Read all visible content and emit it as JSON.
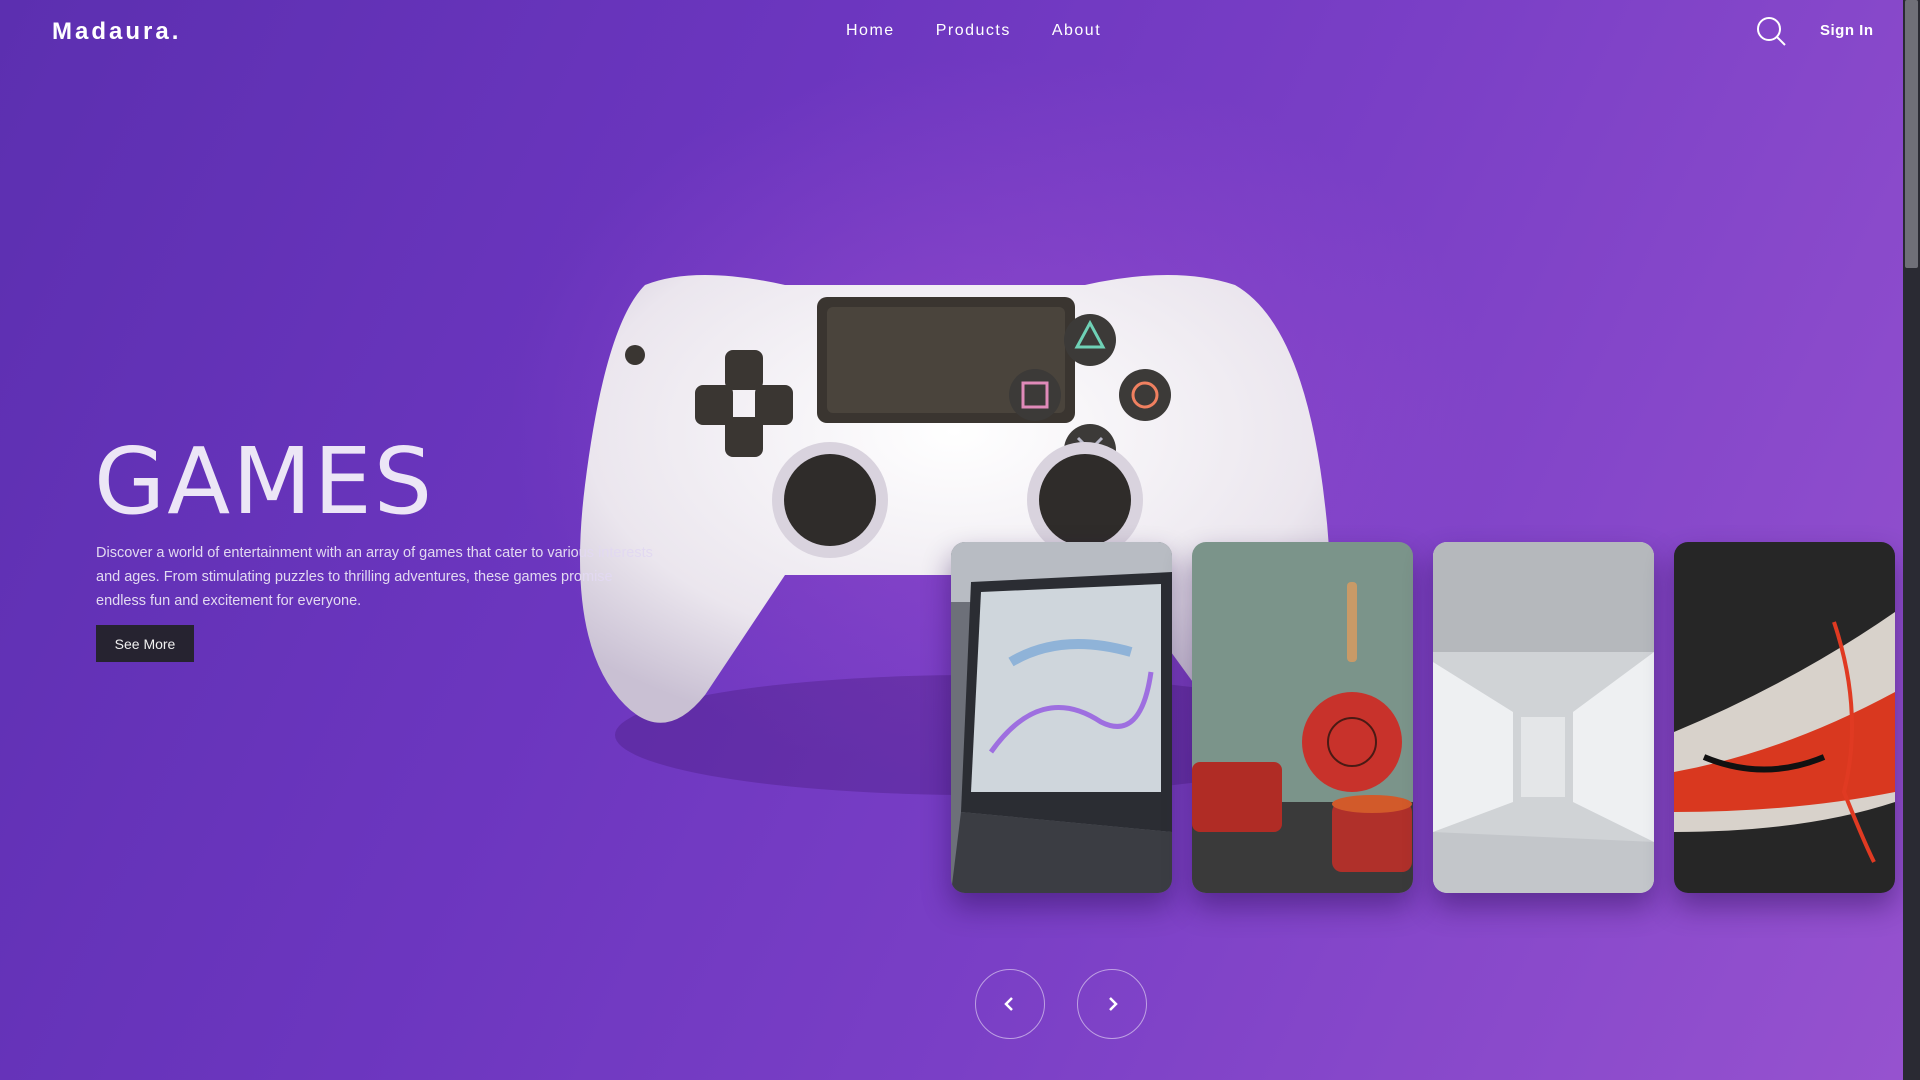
{
  "brand": {
    "logo": "Madaura."
  },
  "nav": {
    "items": [
      "Home",
      "Products",
      "About"
    ]
  },
  "header": {
    "signin_label": "Sign In",
    "search_icon": "search-icon"
  },
  "hero": {
    "title": "GAMES",
    "description": "Discover a world of entertainment with an array of games that cater to various interests and ages. From stimulating puzzles to thrilling adventures, these games promise endless fun and excitement for everyone.",
    "cta_label": "See More"
  },
  "cards": [
    {
      "subject": "laptop"
    },
    {
      "subject": "cookware"
    },
    {
      "subject": "library"
    },
    {
      "subject": "sneaker"
    }
  ],
  "carousel": {
    "prev_icon": "chevron-left-icon",
    "next_icon": "chevron-right-icon"
  },
  "colors": {
    "background": "#6c36bf",
    "accent": "#9652cf"
  }
}
